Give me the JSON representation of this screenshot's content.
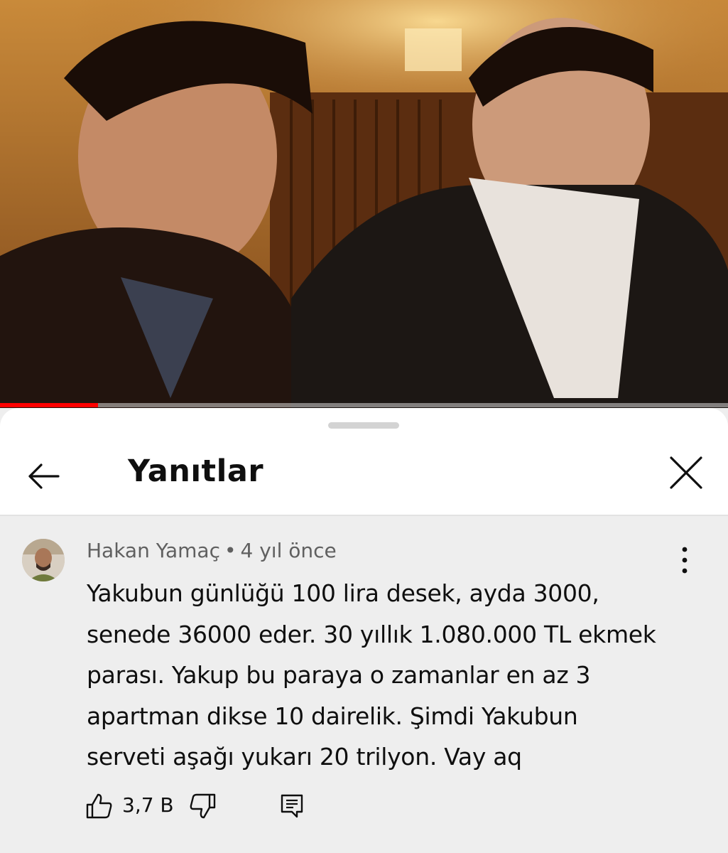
{
  "video": {
    "progress_fraction": 0.135
  },
  "header": {
    "title": "Yanıtlar",
    "back_icon": "arrow-left-icon",
    "close_icon": "close-icon"
  },
  "comment": {
    "author": "Hakan Yamaç",
    "separator": "•",
    "timestamp": "4 yıl önce",
    "text": "Yakubun günlüğü 100 lira desek, ayda 3000,\nsenede 36000 eder. 30 yıllık 1.080.000 TL ekmek\nparası. Yakup bu paraya o zamanlar en az 3\napartman dikse 10 dairelik. Şimdi Yakubun\nserveti aşağı yukarı 20 trilyon. Vay aq",
    "like_count": "3,7 B",
    "icons": [
      "thumbs-up-icon",
      "thumbs-down-icon",
      "reply-icon",
      "more-vert-icon"
    ]
  },
  "colors": {
    "progress": "#ff0000",
    "sheet_bg": "#ffffff",
    "comment_bg": "#eeeeee",
    "primary_text": "#0f0f0f",
    "secondary_text": "#606060"
  }
}
